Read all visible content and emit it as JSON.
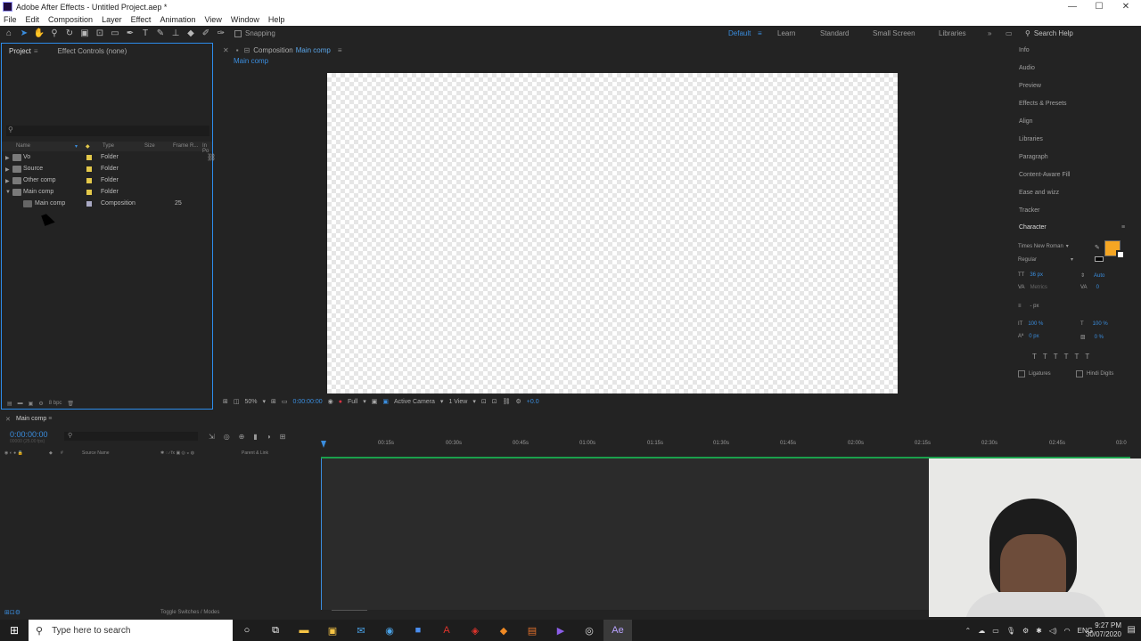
{
  "window": {
    "title": "Adobe After Effects - Untitled Project.aep *",
    "min": "—",
    "max": "☐",
    "close": "✕"
  },
  "menu": [
    "File",
    "Edit",
    "Composition",
    "Layer",
    "Effect",
    "Animation",
    "View",
    "Window",
    "Help"
  ],
  "toolbar": {
    "snapping": "Snapping",
    "workspaces": [
      "Default",
      "Learn",
      "Standard",
      "Small Screen",
      "Libraries"
    ],
    "search_help": "Search Help"
  },
  "project_panel": {
    "tab_project": "Project",
    "tab_effects": "Effect Controls (none)",
    "search_placeholder": "",
    "columns": [
      "Name",
      "Type",
      "Size",
      "Frame R...",
      "In Po"
    ],
    "items": [
      {
        "name": "Vo",
        "type": "Folder",
        "fps": ""
      },
      {
        "name": "Source",
        "type": "Folder",
        "fps": ""
      },
      {
        "name": "Other comp",
        "type": "Folder",
        "fps": ""
      },
      {
        "name": "Main comp",
        "type": "Folder",
        "fps": ""
      },
      {
        "name": "Main comp",
        "type": "Composition",
        "fps": "25"
      }
    ],
    "bpc": "8 bpc"
  },
  "comp_panel": {
    "tab_prefix": "Composition",
    "tab_name": "Main comp",
    "sub_tab": "Main comp",
    "zoom": "50%",
    "timecode": "0:00:00:00",
    "resolution": "Full",
    "camera": "Active Camera",
    "views": "1 View",
    "exposure": "+0.0"
  },
  "right_panel": {
    "items": [
      "Info",
      "Audio",
      "Preview",
      "Effects & Presets",
      "Align",
      "Libraries",
      "Paragraph",
      "Content-Aware Fill",
      "Ease and wizz",
      "Tracker"
    ],
    "character_title": "Character",
    "font": "Times New Roman",
    "style": "Regular",
    "font_size": "36 px",
    "leading": "Auto",
    "kerning": "Metrics",
    "tracking": "0",
    "stroke_width": "- px",
    "v_scale": "100 %",
    "h_scale": "100 %",
    "baseline": "0 px",
    "tsume": "0 %",
    "ligatures": "Ligatures",
    "hindi_digits": "Hindi Digits",
    "fill_color": "#f5a623"
  },
  "timeline": {
    "tab": "Main comp",
    "time": "0:00:00:00",
    "fps_note": "00000 (25.00 fps)",
    "col_source": "Source Name",
    "col_parent": "Parent & Link",
    "ticks": [
      "00:15s",
      "00:30s",
      "00:45s",
      "01:00s",
      "01:15s",
      "01:30s",
      "01:45s",
      "02:00s",
      "02:15s",
      "02:30s",
      "02:45s",
      "03:0"
    ],
    "footer": "Toggle Switches / Modes"
  },
  "taskbar": {
    "search_placeholder": "Type here to search",
    "lang": "ENG",
    "time": "9:27 PM",
    "date": "30/07/2020"
  }
}
